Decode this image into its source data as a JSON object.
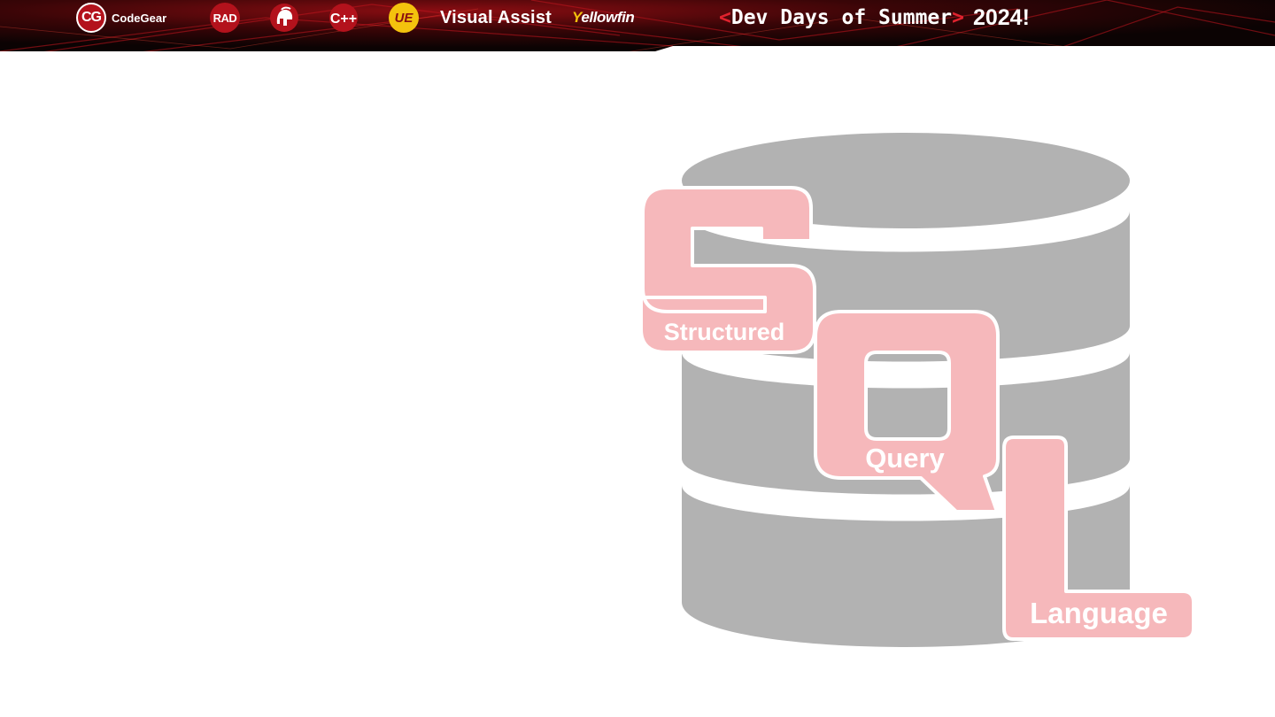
{
  "banner": {
    "logos": {
      "codegear": {
        "mark": "CG",
        "label": "CodeGear"
      },
      "rad": {
        "label": "RAD"
      },
      "spartan": {
        "icon": "spartan-helmet-icon"
      },
      "cpp": {
        "label": "C++"
      },
      "ue": {
        "label": "UE"
      },
      "visual_assist": {
        "label": "Visual Assist"
      },
      "yellowfin": {
        "label_first": "Y",
        "label_rest": "ellowfin"
      }
    },
    "event": {
      "open_bracket": "<",
      "title": "Dev Days of Summer",
      "close_bracket": ">",
      "year": "2024!"
    },
    "colors": {
      "background": "#0b0303",
      "accent": "#e0232e",
      "brand_red": "#b3121c"
    }
  },
  "illustration": {
    "icon": "database-cylinder-icon",
    "letters": {
      "s": "S",
      "q": "Q",
      "l": "L"
    },
    "words": {
      "s": "Structured",
      "q": "Query",
      "l": "Language"
    },
    "colors": {
      "database": "#b2b2b2",
      "letters": "#f6b8bb",
      "word_text": "#ffffff"
    }
  }
}
